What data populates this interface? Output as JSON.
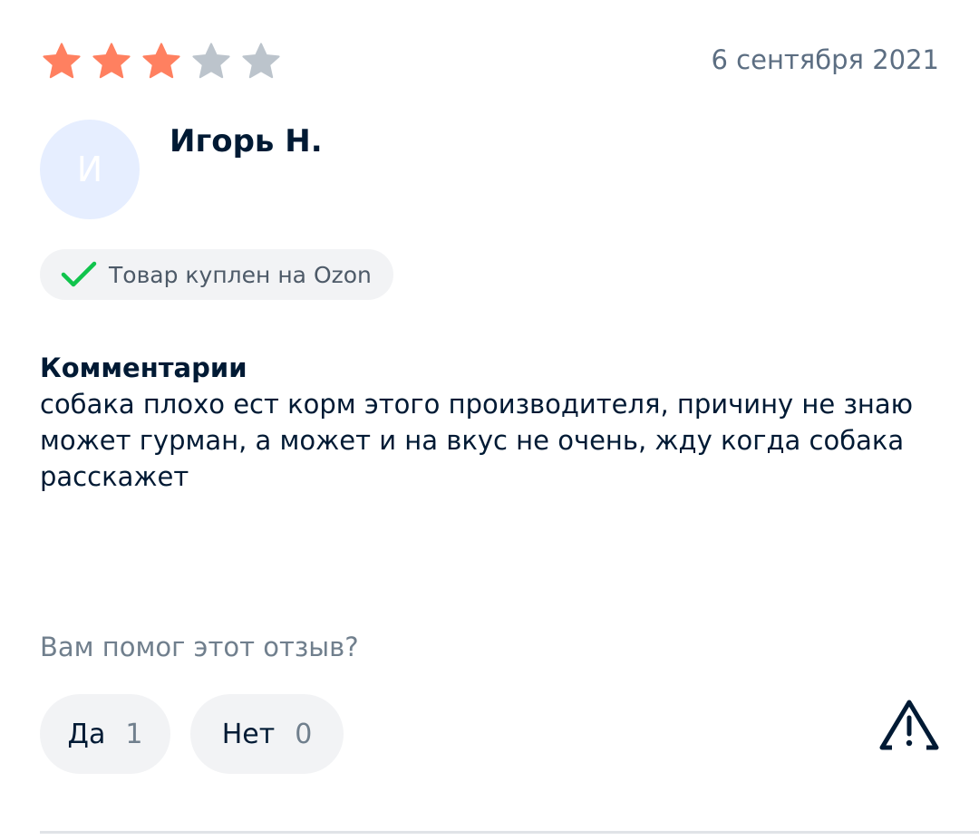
{
  "review": {
    "rating": 3,
    "rating_max": 5,
    "date": "6 сентября 2021",
    "author": {
      "name": "Игорь Н.",
      "avatar_initial": "И"
    },
    "purchase_badge": {
      "icon": "check-icon",
      "label": "Товар куплен на Ozon"
    },
    "comment": {
      "title": "Комментарии",
      "text": "собака плохо ест корм этого производителя, причину не знаю может гурман, а может и на вкус не очень, жду когда собака расскажет"
    },
    "helpful": {
      "question": "Вам помог этот отзыв?",
      "yes_label": "Да",
      "yes_count": "1",
      "no_label": "Нет",
      "no_count": "0"
    },
    "report_icon": "warning-icon"
  },
  "colors": {
    "star_filled": "#ff8060",
    "star_empty": "#bcc4cc",
    "check": "#10c44c",
    "avatar_bg": "#e6eeff",
    "chip_bg": "#f2f3f5"
  }
}
